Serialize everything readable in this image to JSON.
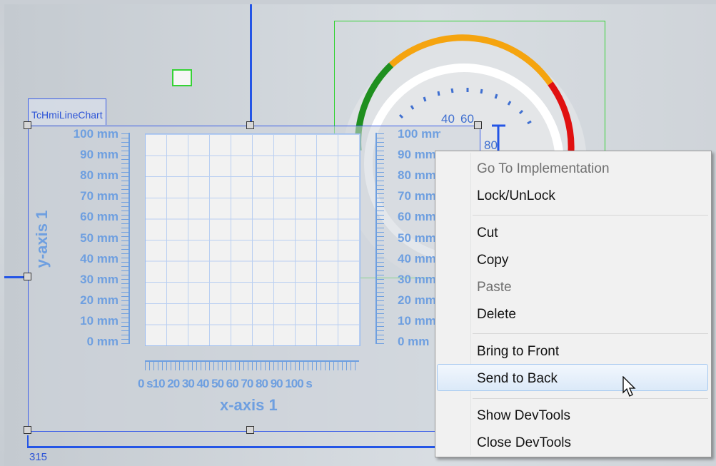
{
  "chart": {
    "control_label": "TcHmiLineChart",
    "y_axis_title": "y-axis 1",
    "x_axis_title": "x-axis 1",
    "y_ticks": [
      "100 mm",
      "90 mm",
      "80 mm",
      "70 mm",
      "60 mm",
      "50 mm",
      "40 mm",
      "30 mm",
      "20 mm",
      "10 mm",
      "0 mm"
    ],
    "x_ticks_text": "0 s10 20 30 40 50 60 70 80 90 100 s"
  },
  "gauge": {
    "labels": [
      "40",
      "60",
      "80"
    ],
    "colors": {
      "green": "#1f8f1f",
      "orange": "#f5a40f",
      "red": "#e01010",
      "ring": "#dfe2e5",
      "ticks": "#3f6fd0"
    }
  },
  "position_readout": "315",
  "context_menu": {
    "items": [
      {
        "label": "Go To Implementation",
        "enabled": false
      },
      {
        "label": "Lock/UnLock",
        "enabled": true
      },
      {
        "label": "Cut",
        "enabled": true
      },
      {
        "label": "Copy",
        "enabled": true
      },
      {
        "label": "Paste",
        "enabled": false
      },
      {
        "label": "Delete",
        "enabled": true
      },
      {
        "label": "Bring to Front",
        "enabled": true
      },
      {
        "label": "Send to Back",
        "enabled": true,
        "hovered": true
      },
      {
        "label": "Show DevTools",
        "enabled": true
      },
      {
        "label": "Close DevTools",
        "enabled": true
      }
    ]
  },
  "accent_colors": {
    "selection_blue": "#2455e6",
    "selection_green": "#35d335",
    "axis_blue": "#6e9fe0"
  }
}
